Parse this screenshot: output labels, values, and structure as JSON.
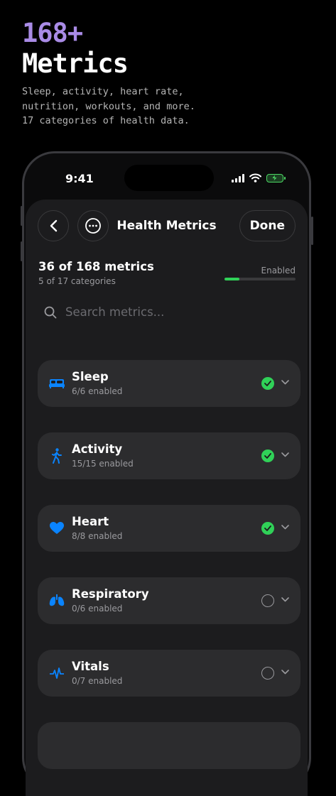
{
  "hero": {
    "count": "168+",
    "title": "Metrics",
    "desc": [
      "Sleep, activity, heart rate,",
      "nutrition, workouts, and more.",
      "17 categories of health data."
    ]
  },
  "status_bar": {
    "time": "9:41"
  },
  "nav": {
    "title": "Health Metrics",
    "done_label": "Done",
    "back_icon": "chevron-left-icon",
    "more_icon": "ellipsis-circle-icon"
  },
  "summary": {
    "count_text": "36 of 168 metrics",
    "categories_text": "5 of 17 categories",
    "enabled_label": "Enabled",
    "progress_fraction": 0.214
  },
  "search": {
    "placeholder": "Search metrics..."
  },
  "colors": {
    "accent": "#0a84ff",
    "enabled": "#30d158",
    "hero": "#a98be6"
  },
  "categories": [
    {
      "title": "Sleep",
      "sub": "6/6 enabled",
      "enabled": true,
      "icon": "bed-icon"
    },
    {
      "title": "Activity",
      "sub": "15/15 enabled",
      "enabled": true,
      "icon": "figure-walk-icon"
    },
    {
      "title": "Heart",
      "sub": "8/8 enabled",
      "enabled": true,
      "icon": "heart-icon"
    },
    {
      "title": "Respiratory",
      "sub": "0/6 enabled",
      "enabled": false,
      "icon": "lungs-icon"
    },
    {
      "title": "Vitals",
      "sub": "0/7 enabled",
      "enabled": false,
      "icon": "waveform-icon"
    }
  ]
}
